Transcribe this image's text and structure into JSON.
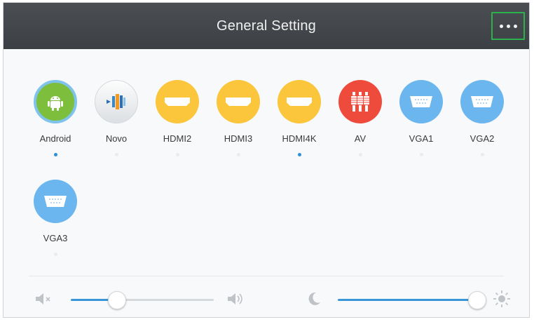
{
  "header": {
    "title": "General Setting",
    "more_icon": "more-horizontal-icon",
    "highlight_color": "#2bb24c"
  },
  "sources": [
    {
      "label": "Android",
      "icon": "android-icon",
      "active": true,
      "color": "#7dbf3c"
    },
    {
      "label": "Novo",
      "icon": "novo-icon",
      "active": false
    },
    {
      "label": "HDMI2",
      "icon": "hdmi-icon",
      "active": false,
      "color": "#fbc53c"
    },
    {
      "label": "HDMI3",
      "icon": "hdmi-icon",
      "active": false,
      "color": "#fbc53c"
    },
    {
      "label": "HDMI4K",
      "icon": "hdmi-icon",
      "active": true,
      "color": "#fbc53c"
    },
    {
      "label": "AV",
      "icon": "av-rca-icon",
      "active": false,
      "color": "#ef4b3d"
    },
    {
      "label": "VGA1",
      "icon": "vga-icon",
      "active": false,
      "color": "#6cb6ef"
    },
    {
      "label": "VGA2",
      "icon": "vga-icon",
      "active": false,
      "color": "#6cb6ef"
    },
    {
      "label": "VGA3",
      "icon": "vga-icon",
      "active": false,
      "color": "#6cb6ef"
    }
  ],
  "controls": {
    "volume": {
      "level": 0.32,
      "left_icon": "volume-mute-icon",
      "right_icon": "volume-up-icon"
    },
    "brightness": {
      "level": 0.97,
      "left_icon": "moon-icon",
      "right_icon": "sun-icon"
    }
  },
  "colors": {
    "accent": "#3a96d8",
    "indicator_active": "#2f8fd6"
  }
}
